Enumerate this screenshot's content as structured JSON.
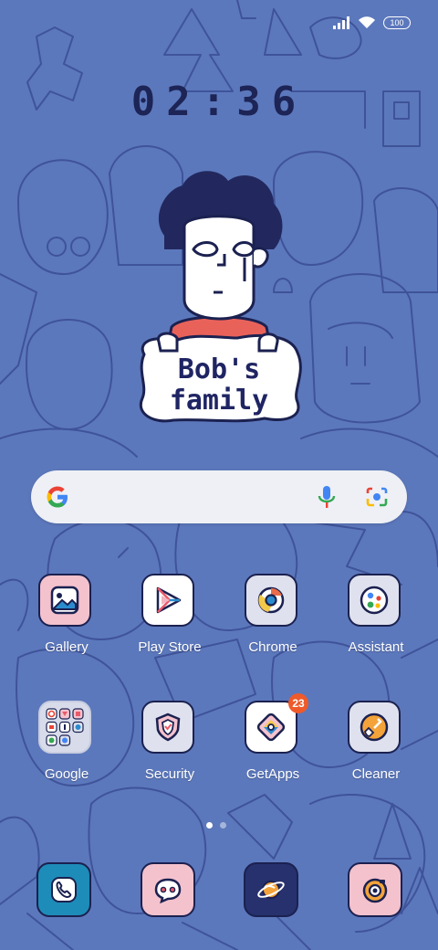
{
  "status_bar": {
    "battery": "100"
  },
  "clock": {
    "time": "02:36"
  },
  "widget": {
    "line1": "Bob's",
    "line2": "family"
  },
  "search": {
    "icons": [
      "google-g-icon",
      "mic-icon",
      "lens-camera-icon"
    ]
  },
  "apps": [
    {
      "label": "Gallery",
      "icon": "gallery-icon"
    },
    {
      "label": "Play Store",
      "icon": "play-store-icon"
    },
    {
      "label": "Chrome",
      "icon": "chrome-icon"
    },
    {
      "label": "Assistant",
      "icon": "assistant-icon"
    },
    {
      "label": "Google",
      "icon": "google-folder-icon"
    },
    {
      "label": "Security",
      "icon": "security-shield-icon"
    },
    {
      "label": "GetApps",
      "icon": "getapps-icon",
      "badge": "23"
    },
    {
      "label": "Cleaner",
      "icon": "cleaner-brush-icon"
    }
  ],
  "dock": [
    {
      "icon": "phone-icon"
    },
    {
      "icon": "messages-icon"
    },
    {
      "icon": "browser-planet-icon"
    },
    {
      "icon": "camera-icon"
    }
  ],
  "pager": {
    "active_page": 1,
    "page_count": 2
  },
  "colors": {
    "wallpaper": "#5c78bc",
    "line_art": "#2f3f86",
    "badge": "#ef5a2a"
  }
}
